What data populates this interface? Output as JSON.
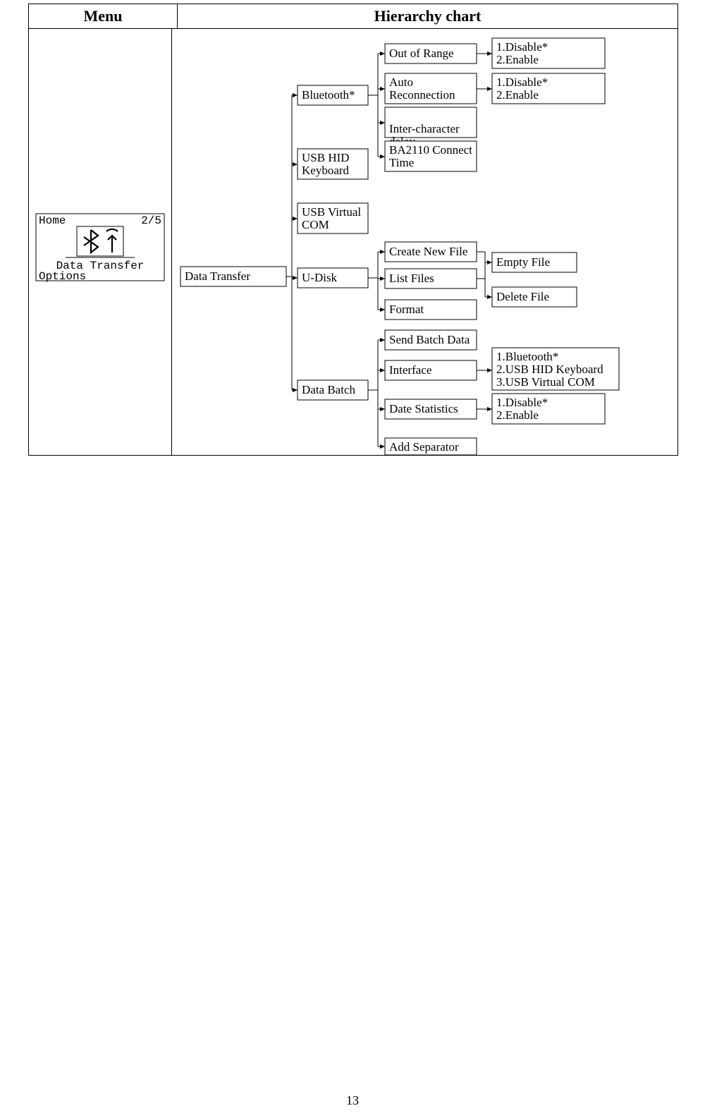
{
  "header": {
    "menu": "Menu",
    "chart": "Hierarchy chart"
  },
  "menu_lcd": {
    "title": "Home",
    "page": "2/5",
    "line1": "Data Transfer",
    "line2": "Options"
  },
  "root": "Data Transfer",
  "l2": {
    "bt": "Bluetooth*",
    "hid": "USB HID Keyboard",
    "vcom": "USB Virtual COM",
    "udisk": "U-Disk",
    "batch": "Data Batch"
  },
  "l3": {
    "oor": "Out of Range",
    "auto": "Auto Reconnection",
    "icd": "Inter-character delay",
    "baconn": "BA2110 Connect Time",
    "cnew": "Create New File",
    "lfiles": "List Files",
    "format": "Format",
    "sendb": "Send Batch Data",
    "iface": "Interface",
    "dstat": "Date Statistics",
    "addsep": "Add Separator"
  },
  "l4": {
    "disen_a": "1.Disable*\n2.Enable",
    "disen_b": "1.Disable*\n2.Enable",
    "empty": "Empty File",
    "delete": "Delete File",
    "iface_opts": "1.Bluetooth*\n2.USB HID Keyboard\n3.USB Virtual COM",
    "disen_c": "1.Disable*\n2.Enable"
  },
  "page_number": "13"
}
